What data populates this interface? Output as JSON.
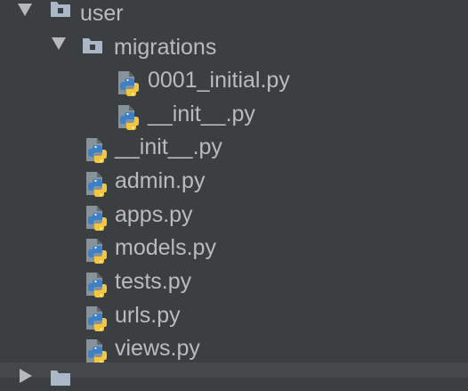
{
  "project_tree": {
    "user_folder": {
      "label": "user",
      "expanded": true
    },
    "migrations_folder": {
      "label": "migrations",
      "expanded": true
    },
    "migration_files": [
      {
        "label": "0001_initial.py",
        "icon": "python-file-icon"
      },
      {
        "label": "__init__.py",
        "icon": "python-file-icon"
      }
    ],
    "user_files": [
      {
        "label": "__init__.py",
        "icon": "python-file-icon"
      },
      {
        "label": "admin.py",
        "icon": "python-file-icon"
      },
      {
        "label": "apps.py",
        "icon": "python-file-icon"
      },
      {
        "label": "models.py",
        "icon": "python-file-icon"
      },
      {
        "label": "tests.py",
        "icon": "python-file-icon"
      },
      {
        "label": "urls.py",
        "icon": "python-file-icon"
      },
      {
        "label": "views.py",
        "icon": "python-file-icon"
      }
    ],
    "collapsed_folder": {
      "label": "",
      "expanded": false
    }
  },
  "colors": {
    "background": "#3c3f41",
    "text": "#bbbbbb",
    "arrow": "#b8b8b8",
    "folder": "#a9b7c6",
    "python_blue": "#3f7fc6",
    "python_yellow": "#f4c63d",
    "file_page": "#87939a"
  }
}
